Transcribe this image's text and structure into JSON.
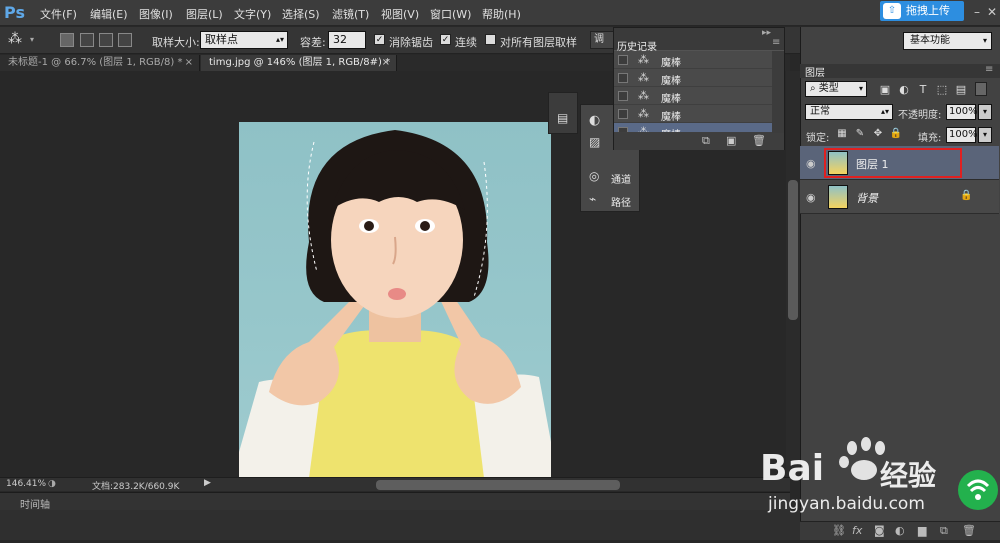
{
  "app": {
    "logo": "Ps",
    "upload_button": "拖拽上传"
  },
  "menu": [
    "文件(F)",
    "编辑(E)",
    "图像(I)",
    "图层(L)",
    "文字(Y)",
    "选择(S)",
    "滤镜(T)",
    "视图(V)",
    "窗口(W)",
    "帮助(H)"
  ],
  "options": {
    "sample_size_label": "取样大小:",
    "sample_size_value": "取样点",
    "tolerance_label": "容差:",
    "tolerance_value": "32",
    "antialias_label": "消除锯齿",
    "contiguous_label": "连续",
    "all_layers_label": "对所有图层取样",
    "refine_label": "调整"
  },
  "tabs": [
    {
      "label": "未标题-1 @ 66.7% (图层 1, RGB/8) *"
    },
    {
      "label": "timg.jpg @ 146% (图层 1, RGB/8#) *"
    }
  ],
  "history": {
    "title": "历史记录",
    "items": [
      "魔棒",
      "魔棒",
      "魔棒",
      "魔棒",
      "魔棒"
    ]
  },
  "mini_panels": {
    "channels": "通道",
    "paths": "路径"
  },
  "status": {
    "zoom": "146.41%",
    "doc": "文档:283.2K/660.9K"
  },
  "timeline": {
    "label": "时间轴"
  },
  "workspace": {
    "label": "基本功能"
  },
  "layers": {
    "tab": "图层",
    "filter_kind": "类型",
    "blend_mode": "正常",
    "opacity_label": "不透明度:",
    "opacity_value": "100%",
    "lock_label": "锁定:",
    "fill_label": "填充:",
    "fill_value": "100%",
    "items": [
      {
        "name": "图层 1",
        "selected": true,
        "highlight_color": "#e02020"
      },
      {
        "name": "背景",
        "locked": true
      }
    ]
  },
  "watermark": {
    "brand": "Bai",
    "brand2": "经验",
    "url": "jingyan.baidu.com"
  }
}
